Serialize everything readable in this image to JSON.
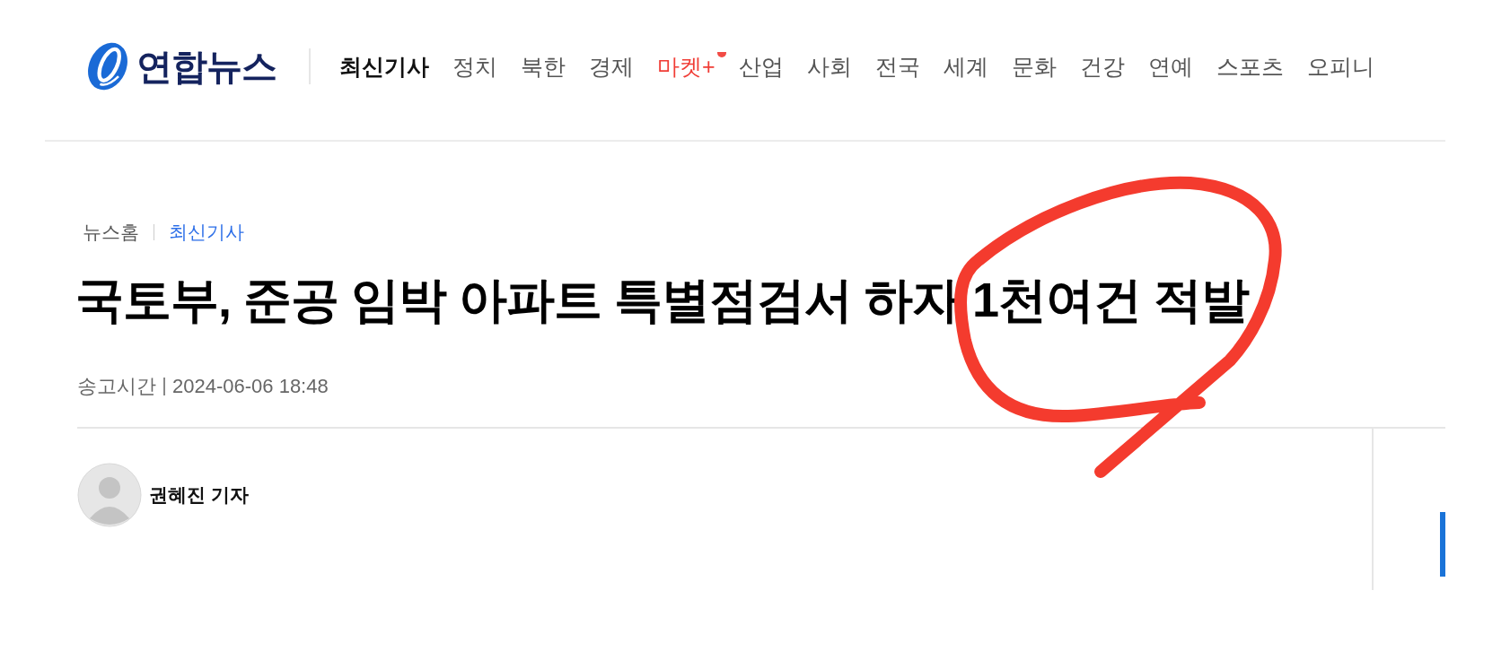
{
  "header": {
    "logo": {
      "text": "연합뉴스"
    },
    "nav": [
      {
        "label": "최신기사",
        "selected": true,
        "new_dot": false,
        "highlight": false
      },
      {
        "label": "정치",
        "selected": false,
        "new_dot": false,
        "highlight": false
      },
      {
        "label": "북한",
        "selected": false,
        "new_dot": false,
        "highlight": false
      },
      {
        "label": "경제",
        "selected": false,
        "new_dot": false,
        "highlight": false
      },
      {
        "label": "마켓+",
        "selected": false,
        "new_dot": true,
        "highlight": true
      },
      {
        "label": "산업",
        "selected": false,
        "new_dot": false,
        "highlight": false
      },
      {
        "label": "사회",
        "selected": false,
        "new_dot": false,
        "highlight": false
      },
      {
        "label": "전국",
        "selected": false,
        "new_dot": false,
        "highlight": false
      },
      {
        "label": "세계",
        "selected": false,
        "new_dot": false,
        "highlight": false
      },
      {
        "label": "문화",
        "selected": false,
        "new_dot": false,
        "highlight": false
      },
      {
        "label": "건강",
        "selected": false,
        "new_dot": false,
        "highlight": false
      },
      {
        "label": "연예",
        "selected": false,
        "new_dot": false,
        "highlight": false
      },
      {
        "label": "스포츠",
        "selected": false,
        "new_dot": false,
        "highlight": false
      },
      {
        "label": "오피니",
        "selected": false,
        "new_dot": false,
        "highlight": false
      }
    ]
  },
  "breadcrumb": [
    {
      "label": "뉴스홈",
      "selected": false
    },
    {
      "label": "최신기사",
      "selected": true
    }
  ],
  "article": {
    "headline": "국토부, 준공 임박 아파트 특별점검서 하자 1천여건 적발",
    "sent_label": "송고시간",
    "sent_time": "2024-06-06 18:48",
    "author": "권혜진 기자"
  },
  "annotations": [
    {
      "kind": "freehand-circle"
    }
  ]
}
